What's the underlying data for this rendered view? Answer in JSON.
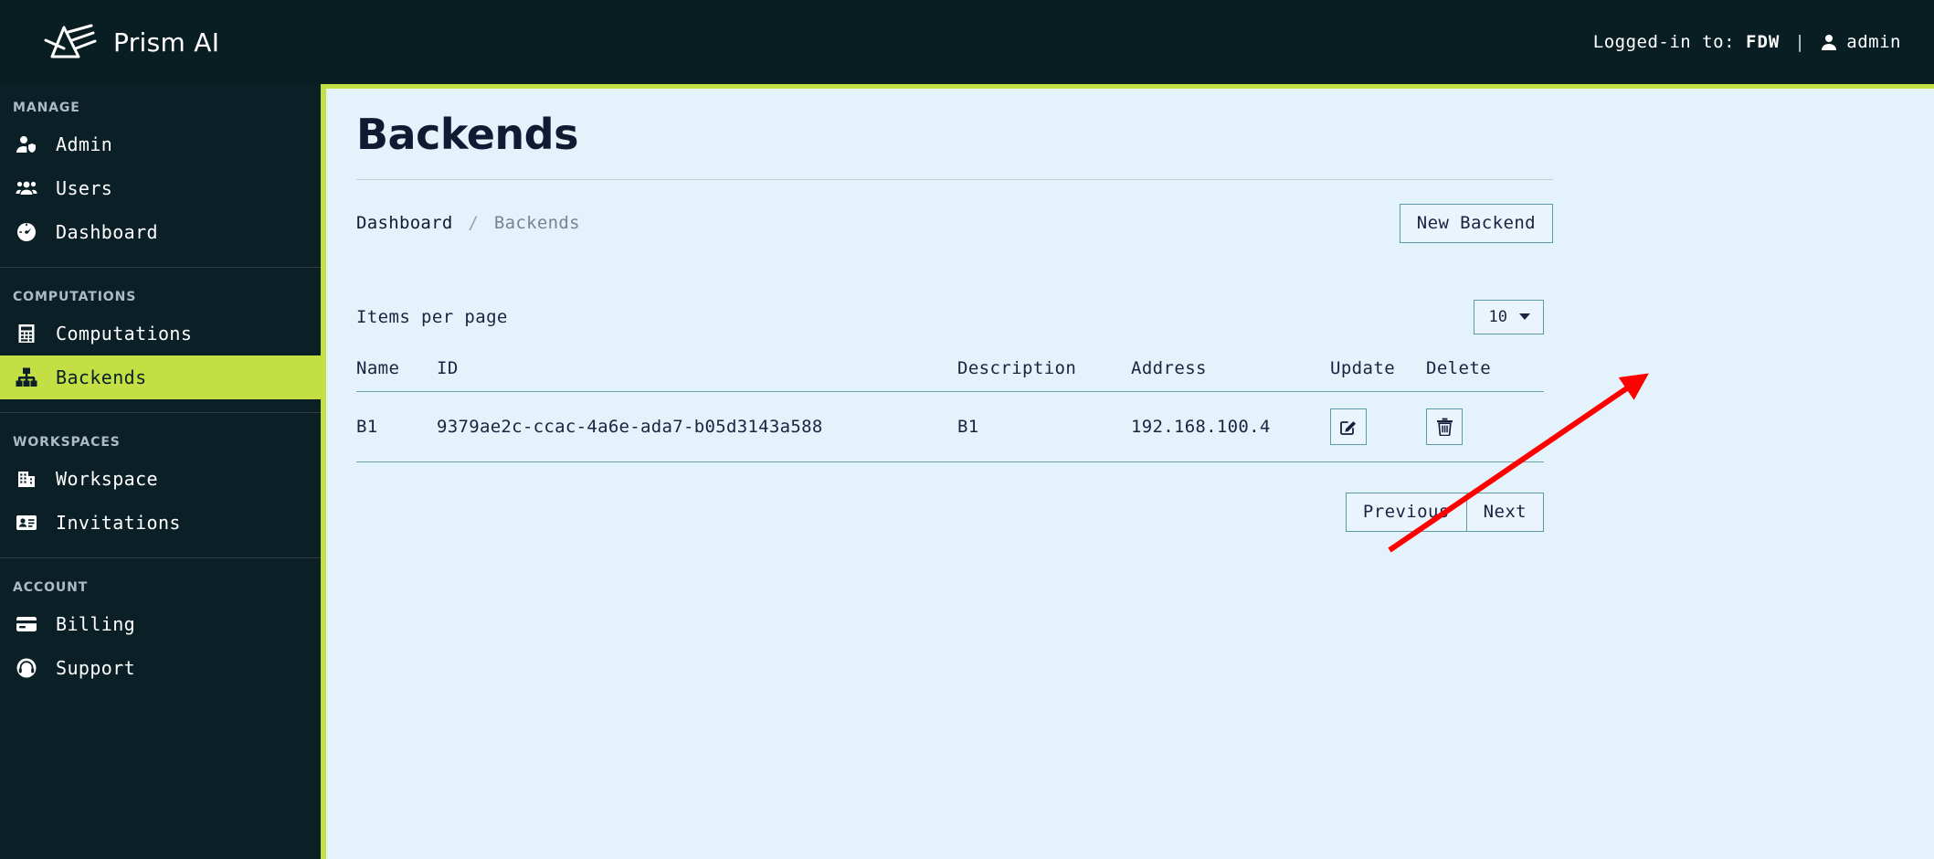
{
  "topbar": {
    "brand_name": "Prism AI",
    "logo_icon": "prism-logo-icon",
    "logged_in_label": "Logged-in to:",
    "tenant": "FDW",
    "separator": "|",
    "user_icon": "user-icon",
    "username": "admin"
  },
  "sidebar": {
    "groups": [
      {
        "label": "MANAGE",
        "items": [
          {
            "label": "Admin",
            "icon": "user-shield-icon",
            "active": false
          },
          {
            "label": "Users",
            "icon": "users-group-icon",
            "active": false
          },
          {
            "label": "Dashboard",
            "icon": "dashboard-gauge-icon",
            "active": false
          }
        ]
      },
      {
        "label": "COMPUTATIONS",
        "items": [
          {
            "label": "Computations",
            "icon": "calculator-icon",
            "active": false
          },
          {
            "label": "Backends",
            "icon": "sitemap-icon",
            "active": true
          }
        ]
      },
      {
        "label": "WORKSPACES",
        "items": [
          {
            "label": "Workspace",
            "icon": "building-icon",
            "active": false
          },
          {
            "label": "Invitations",
            "icon": "id-card-icon",
            "active": false
          }
        ]
      },
      {
        "label": "ACCOUNT",
        "items": [
          {
            "label": "Billing",
            "icon": "credit-card-icon",
            "active": false
          },
          {
            "label": "Support",
            "icon": "headset-icon",
            "active": false
          }
        ]
      }
    ]
  },
  "main": {
    "page_title": "Backends",
    "breadcrumb": {
      "parent": "Dashboard",
      "separator": "/",
      "current": "Backends"
    },
    "new_backend_button": "New Backend",
    "items_per_page_label": "Items per page",
    "items_per_page_value": "10",
    "items_per_page_options": [
      "10"
    ],
    "table": {
      "columns": [
        "Name",
        "ID",
        "Description",
        "Address",
        "Update",
        "Delete"
      ],
      "rows": [
        {
          "name": "B1",
          "id": "9379ae2c-ccac-4a6e-ada7-b05d3143a588",
          "description": "B1",
          "address": "192.168.100.4",
          "update_icon": "edit-pencil-square-icon",
          "delete_icon": "trash-icon"
        }
      ]
    },
    "pagination": {
      "previous": "Previous",
      "next": "Next"
    }
  },
  "annotation": {
    "type": "arrow",
    "color": "#ff0000",
    "points_to": "delete-button-row-0"
  },
  "colors": {
    "accent_green": "#c4df43",
    "dark_navy": "#081e23",
    "sidebar": "#0a2026",
    "content_bg": "#e4f2fb",
    "border_teal": "#5e9aa4",
    "text_dark": "#1a2340",
    "annotation_red": "#ff0000"
  }
}
